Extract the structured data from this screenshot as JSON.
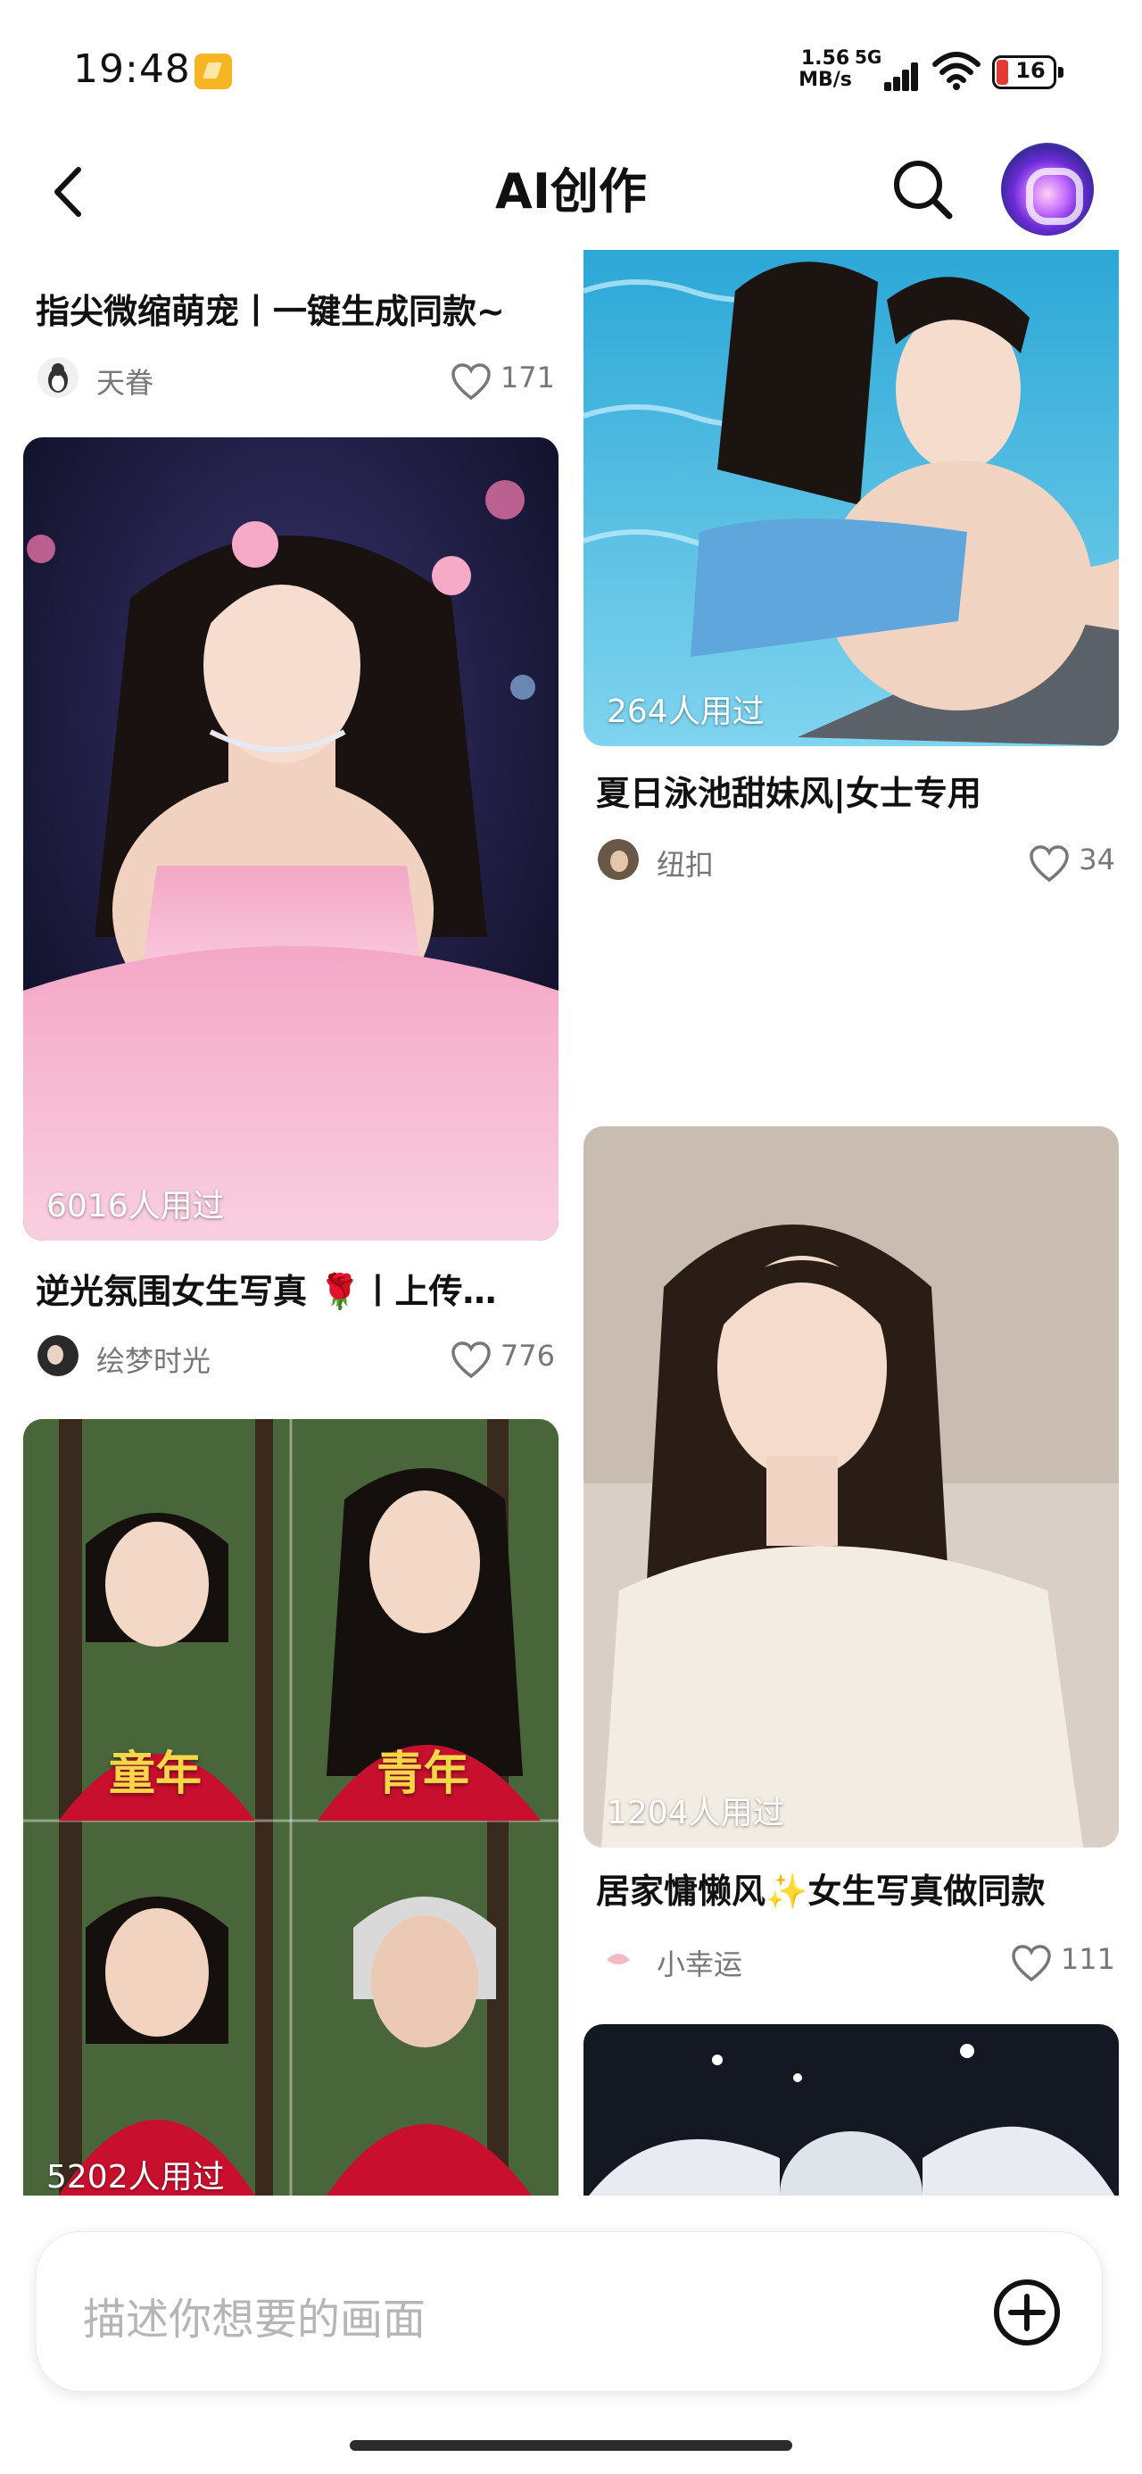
{
  "status_bar": {
    "time": "19:48",
    "net_speed_value": "1.56",
    "net_speed_unit": "MB/s",
    "network_type": "5G",
    "battery_level": "16",
    "notification_color": "#f6b624"
  },
  "header": {
    "title": "AI创作",
    "back_icon": "chevron-left-icon",
    "search_icon": "search-icon",
    "avatar_icon": "ai-avatar-icon"
  },
  "feed": {
    "left": [
      {
        "title": "指尖微缩萌宠丨一键生成同款~",
        "author": "天眷",
        "likes": "171"
      },
      {
        "used": "6016人用过",
        "title": "逆光氛围女生写真 🌹丨上传…",
        "author": "绘梦时光",
        "likes": "776"
      },
      {
        "used": "5202人用过",
        "labels": [
          "童年",
          "青年"
        ]
      }
    ],
    "right": [
      {
        "used": "264人用过",
        "title": "夏日泳池甜妹风|女士专用",
        "author": "纽扣",
        "likes": "34"
      },
      {
        "used": "1204人用过",
        "title": "居家慵懒风✨女生写真做同款",
        "author": "小幸运",
        "likes": "111"
      },
      {
        "used": ""
      }
    ]
  },
  "input": {
    "placeholder": "描述你想要的画面",
    "add_icon": "plus-circle-icon"
  },
  "colors": {
    "text_primary": "#111111",
    "text_secondary": "#777777",
    "placeholder": "#b5b5b5",
    "badge_red": "#c8102e",
    "badge_text": "#f7d64a"
  }
}
